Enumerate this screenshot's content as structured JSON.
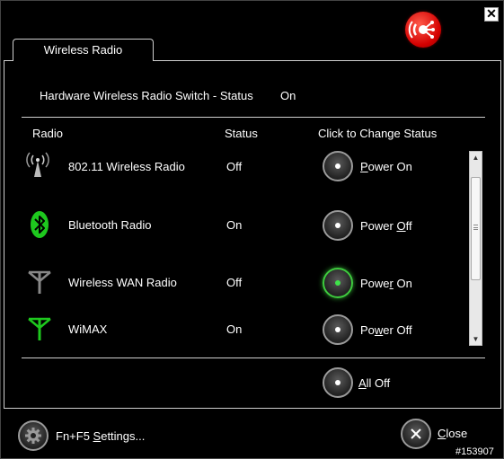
{
  "window": {
    "close_glyph": "✕",
    "tab_label": "Wireless Radio"
  },
  "hardware": {
    "label": "Hardware Wireless Radio Switch - Status",
    "value": "On"
  },
  "columns": {
    "radio": "Radio",
    "status": "Status",
    "action": "Click to Change Status"
  },
  "radios": [
    {
      "name": "802.11 Wireless Radio",
      "status": "Off",
      "button_label": "Power On",
      "icon": "wifi-antenna-icon",
      "active": false
    },
    {
      "name": "Bluetooth Radio",
      "status": "On",
      "button_label": "Power Off",
      "icon": "bluetooth-icon",
      "active": false
    },
    {
      "name": "Wireless WAN Radio",
      "status": "Off",
      "button_label": "Power On",
      "icon": "wwan-antenna-icon",
      "active": true
    },
    {
      "name": "WiMAX",
      "status": "On",
      "button_label": "Power Off",
      "icon": "wimax-antenna-icon",
      "active": false
    }
  ],
  "all_off": {
    "label": "All Off"
  },
  "footer": {
    "settings_label": "Fn+F5 Settings...",
    "close_label": "Close"
  },
  "watermark": "#153907",
  "colors": {
    "background": "#000000",
    "active_green": "#3fe34a",
    "logo_red": "#d40000",
    "text": "#ffffff"
  }
}
